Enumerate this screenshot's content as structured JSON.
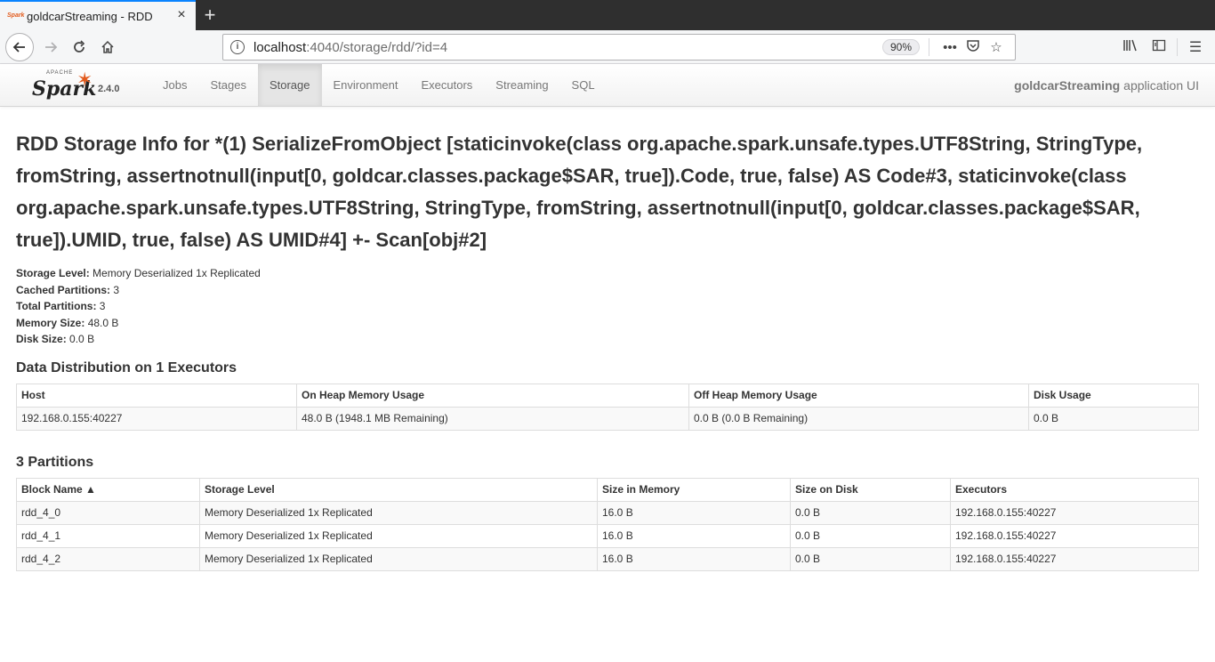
{
  "browser": {
    "tab_title": "goldcarStreaming - RDD",
    "tab_favicon": "Spark",
    "url_host": "localhost",
    "url_path": ":4040/storage/rdd/?id=4",
    "zoom": "90%"
  },
  "spark": {
    "logo_apache": "APACHE",
    "logo_text": "Spark",
    "version": "2.4.0",
    "nav": [
      "Jobs",
      "Stages",
      "Storage",
      "Environment",
      "Executors",
      "Streaming",
      "SQL"
    ],
    "active_tab": "Storage",
    "app_name": "goldcarStreaming",
    "app_suffix": "application UI"
  },
  "page": {
    "title": "RDD Storage Info for *(1) SerializeFromObject [staticinvoke(class org.apache.spark.unsafe.types.UTF8String, StringType, fromString, assertnotnull(input[0, goldcar.classes.package$SAR, true]).Code, true, false) AS Code#3, staticinvoke(class org.apache.spark.unsafe.types.UTF8String, StringType, fromString, assertnotnull(input[0, goldcar.classes.package$SAR, true]).UMID, true, false) AS UMID#4] +- Scan[obj#2]",
    "summary": [
      {
        "label": "Storage Level:",
        "value": "Memory Deserialized 1x Replicated"
      },
      {
        "label": "Cached Partitions:",
        "value": "3"
      },
      {
        "label": "Total Partitions:",
        "value": "3"
      },
      {
        "label": "Memory Size:",
        "value": "48.0 B"
      },
      {
        "label": "Disk Size:",
        "value": "0.0 B"
      }
    ],
    "distribution": {
      "heading": "Data Distribution on 1 Executors",
      "columns": [
        "Host",
        "On Heap Memory Usage",
        "Off Heap Memory Usage",
        "Disk Usage"
      ],
      "rows": [
        [
          "192.168.0.155:40227",
          "48.0 B (1948.1 MB Remaining)",
          "0.0 B (0.0 B Remaining)",
          "0.0 B"
        ]
      ]
    },
    "partitions": {
      "heading": "3 Partitions",
      "columns": [
        "Block Name ▲",
        "Storage Level",
        "Size in Memory",
        "Size on Disk",
        "Executors"
      ],
      "rows": [
        [
          "rdd_4_0",
          "Memory Deserialized 1x Replicated",
          "16.0 B",
          "0.0 B",
          "192.168.0.155:40227"
        ],
        [
          "rdd_4_1",
          "Memory Deserialized 1x Replicated",
          "16.0 B",
          "0.0 B",
          "192.168.0.155:40227"
        ],
        [
          "rdd_4_2",
          "Memory Deserialized 1x Replicated",
          "16.0 B",
          "0.0 B",
          "192.168.0.155:40227"
        ]
      ]
    }
  }
}
